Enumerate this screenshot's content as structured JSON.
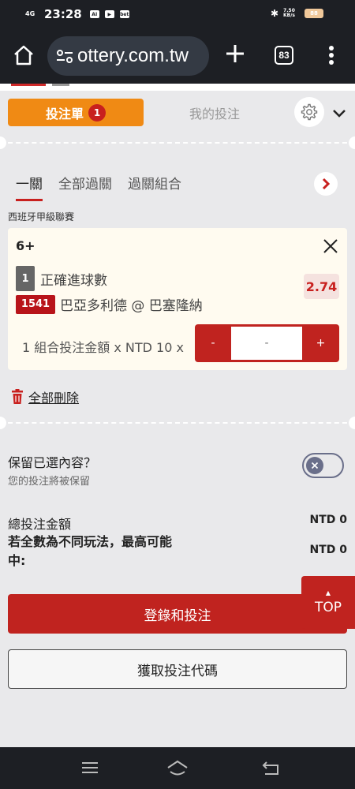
{
  "status_bar": {
    "signal": "4G",
    "time": "23:28",
    "notif_icons": [
      "AI",
      "▶",
      "bet"
    ],
    "speed_top": "7.50",
    "speed_bottom": "KB/s",
    "battery": "88"
  },
  "browser": {
    "url": "ottery.com.tw",
    "tab_count": "83"
  },
  "betslip": {
    "tab_label": "投注單",
    "tab_count": "1",
    "mybets_label": "我的投注"
  },
  "sub_tabs": [
    "一關",
    "全部過關",
    "過關組合"
  ],
  "league": "西班牙甲級聯賽",
  "bet": {
    "selection": "6+",
    "market_num": "1",
    "market_name": "正確進球數",
    "match_id": "1541",
    "match_name": "巴亞多利德 @ 巴塞隆納",
    "odds": "2.74",
    "stake_label": "1 組合投注金額 x NTD 10 x",
    "stepper_minus": "-",
    "stepper_value": "-",
    "stepper_plus": "+"
  },
  "delete_all": "全部刪除",
  "retain": {
    "title": "保留已選內容？",
    "subtitle": "您的投注將被保留"
  },
  "summary": {
    "total_label": "總投注金額",
    "total_value": "NTD 0",
    "maxwin_label": "若全數為不同玩法，最高可能中:",
    "maxwin_value": "NTD 0"
  },
  "buttons": {
    "login_bet": "登錄和投注",
    "get_code": "獲取投注代碼",
    "top": "TOP"
  },
  "colors": {
    "brand_red": "#c0231f",
    "orange": "#f08a14"
  }
}
